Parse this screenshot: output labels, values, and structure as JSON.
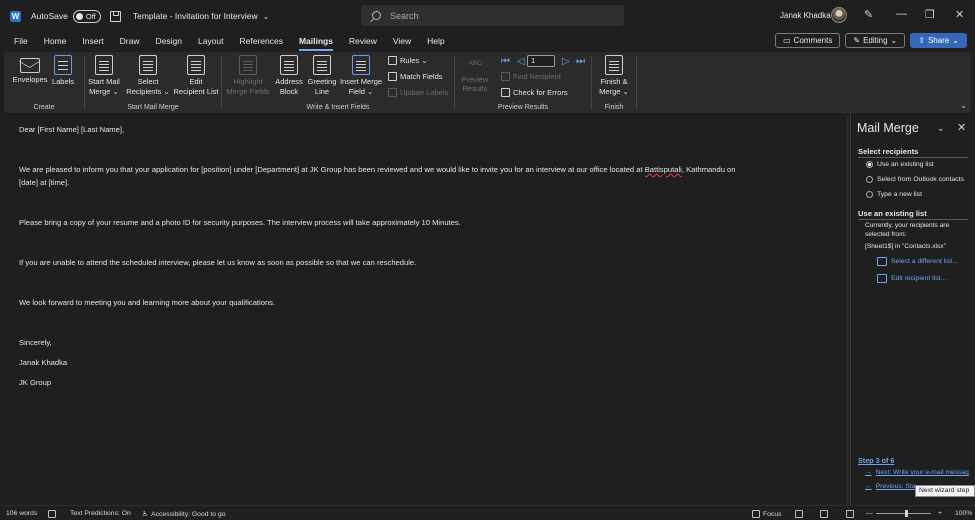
{
  "titlebar": {
    "autosave_label": "AutoSave",
    "autosave_state": "Off",
    "document_title": "Template - Invitation for Interview",
    "search_placeholder": "Search",
    "user_name": "Janak Khadka",
    "minimize": "—",
    "restore": "❐",
    "close": "✕"
  },
  "menu": {
    "tabs": [
      "File",
      "Home",
      "Insert",
      "Draw",
      "Design",
      "Layout",
      "References",
      "Mailings",
      "Review",
      "View",
      "Help"
    ],
    "active_tab": "Mailings",
    "comments_label": "Comments",
    "editing_label": "Editing",
    "share_label": "Share"
  },
  "ribbon": {
    "create": {
      "label": "Create",
      "envelopes": "Envelopes",
      "labels": "Labels"
    },
    "start_mail_merge": {
      "label": "Start Mail Merge",
      "start_l1": "Start Mail",
      "start_l2": "Merge ⌄",
      "select_l1": "Select",
      "select_l2": "Recipients ⌄",
      "edit_l1": "Edit",
      "edit_l2": "Recipient List"
    },
    "write_insert": {
      "label": "Write & Insert Fields",
      "highlight_l1": "Highlight",
      "highlight_l2": "Merge Fields",
      "address_l1": "Address",
      "address_l2": "Block",
      "greeting_l1": "Greeting",
      "greeting_l2": "Line",
      "insert_l1": "Insert Merge",
      "insert_l2": "Field ⌄",
      "rules": "Rules ⌄",
      "match_fields": "Match Fields",
      "update_labels": "Update Labels"
    },
    "preview": {
      "label": "Preview Results",
      "abc": "ABC",
      "preview_l1": "Preview",
      "preview_l2": "Results",
      "record": "1",
      "find_recipient": "Find Recipient",
      "check_errors": "Check for Errors"
    },
    "finish": {
      "label": "Finish",
      "finish_l1": "Finish &",
      "finish_l2": "Merge ⌄"
    }
  },
  "document": {
    "lines": [
      "Dear [First Name] [Last Name],",
      "We are pleased to inform you that your application for [position] under [Department] at JK Group has been reviewed and we would like to invite you for an interview at our office located at ",
      "Battisputali",
      ", Kathmandu on",
      "[date] at [time].",
      "Please bring a copy of your resume and a photo ID for security purposes. The interview process will take approximately 10 Minutes.",
      "If you are unable to attend the scheduled interview, please let us know as soon as possible so that we can reschedule.",
      "We look forward to meeting you and learning more about your qualifications.",
      "Sincerely,",
      "Janak Khadka",
      "JK Group"
    ]
  },
  "pane": {
    "title": "Mail Merge",
    "select_recipients_heading": "Select recipients",
    "options": [
      "Use an existing list",
      "Select from Outlook contacts",
      "Type a new list"
    ],
    "selected_option": 0,
    "use_existing_heading": "Use an existing list",
    "currently_text": "Currently, your recipients are selected from:",
    "source_text": "[Sheet1$] in \"Contacts.xlsx\"",
    "select_different": "Select a different list...",
    "edit_list": "Edit recipient list...",
    "step": "Step 3 of 6",
    "next_link": "Next: Write your e-mail messag",
    "prev_link": "Previous: Sta",
    "tooltip": "Next wizard step"
  },
  "status": {
    "words": "106 words",
    "text_predictions": "Text Predictions: On",
    "accessibility": "Accessibility: Good to go",
    "focus": "Focus",
    "zoom": "100%",
    "zoom_level": 1.0
  }
}
